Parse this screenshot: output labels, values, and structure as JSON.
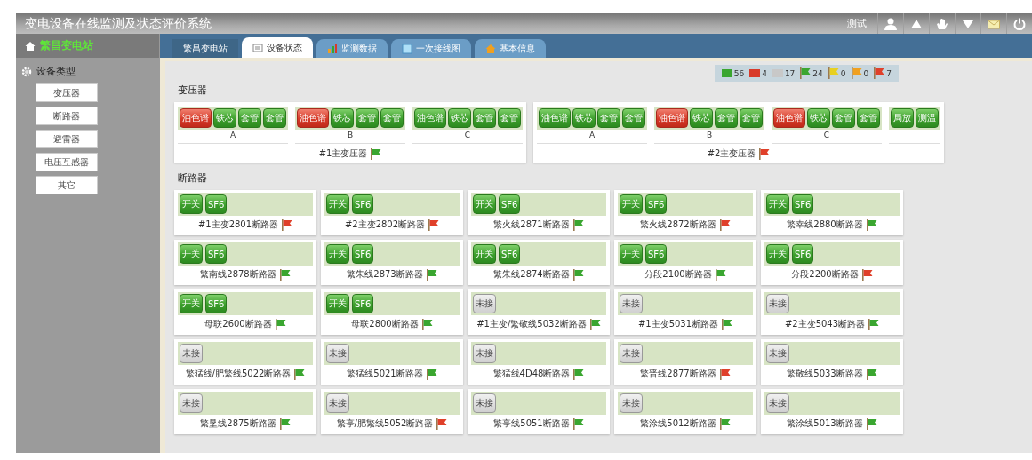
{
  "window": {
    "title": "变电设备在线监测及状态评价系统",
    "user": "测试"
  },
  "station": {
    "name": "繁昌变电站"
  },
  "tabs": [
    {
      "label": "繁昌变电站",
      "selected": false
    },
    {
      "label": "设备状态",
      "selected": true
    },
    {
      "label": "监测数据",
      "selected": false
    },
    {
      "label": "一次接线图",
      "selected": false
    },
    {
      "label": "基本信息",
      "selected": false
    }
  ],
  "sidebar": {
    "title": "设备类型",
    "items": [
      {
        "label": "变压器"
      },
      {
        "label": "断路器"
      },
      {
        "label": "避雷器"
      },
      {
        "label": "电压互感器"
      },
      {
        "label": "其它"
      }
    ]
  },
  "legend": [
    {
      "kind": "block",
      "color": "#3aa630",
      "count": "56"
    },
    {
      "kind": "block",
      "color": "#d83a2a",
      "count": "4"
    },
    {
      "kind": "block",
      "color": "#c8c8c8",
      "count": "17"
    },
    {
      "kind": "flag",
      "color": "#3aa630",
      "count": "24"
    },
    {
      "kind": "flag",
      "color": "#e8d020",
      "count": "0"
    },
    {
      "kind": "flag",
      "color": "#f0a020",
      "count": "0"
    },
    {
      "kind": "flag",
      "color": "#e0402a",
      "count": "7"
    }
  ],
  "transformer_section": {
    "title": "变压器",
    "units": [
      {
        "name": "#1主变压器",
        "color": "#3aa630",
        "groups": [
          {
            "phase": "A",
            "sensors": [
              {
                "label": "油色谱",
                "kind": "alarm"
              },
              {
                "label": "铁芯",
                "kind": "normal"
              },
              {
                "label": "套管",
                "kind": "normal"
              },
              {
                "label": "套管",
                "kind": "normal"
              }
            ]
          },
          {
            "phase": "B",
            "sensors": [
              {
                "label": "油色谱",
                "kind": "alarm"
              },
              {
                "label": "铁芯",
                "kind": "normal"
              },
              {
                "label": "套管",
                "kind": "normal"
              },
              {
                "label": "套管",
                "kind": "normal"
              }
            ]
          },
          {
            "phase": "C",
            "sensors": [
              {
                "label": "油色谱",
                "kind": "normal"
              },
              {
                "label": "铁芯",
                "kind": "normal"
              },
              {
                "label": "套管",
                "kind": "normal"
              },
              {
                "label": "套管",
                "kind": "normal"
              }
            ]
          }
        ]
      },
      {
        "name": "#2主变压器",
        "color": "#e0402a",
        "groups": [
          {
            "phase": "A",
            "sensors": [
              {
                "label": "油色谱",
                "kind": "normal"
              },
              {
                "label": "铁芯",
                "kind": "normal"
              },
              {
                "label": "套管",
                "kind": "normal"
              },
              {
                "label": "套管",
                "kind": "normal"
              }
            ]
          },
          {
            "phase": "B",
            "sensors": [
              {
                "label": "油色谱",
                "kind": "alarm"
              },
              {
                "label": "铁芯",
                "kind": "normal"
              },
              {
                "label": "套管",
                "kind": "normal"
              },
              {
                "label": "套管",
                "kind": "normal"
              }
            ]
          },
          {
            "phase": "C",
            "sensors": [
              {
                "label": "油色谱",
                "kind": "alarm"
              },
              {
                "label": "铁芯",
                "kind": "normal"
              },
              {
                "label": "套管",
                "kind": "normal"
              },
              {
                "label": "套管",
                "kind": "normal"
              }
            ]
          },
          {
            "sensors": [
              {
                "label": "局放",
                "kind": "normal"
              },
              {
                "label": "测温",
                "kind": "normal"
              }
            ]
          }
        ]
      }
    ]
  },
  "breaker_section": {
    "title": "断路器",
    "units": [
      {
        "name": "#1主变2801断路器",
        "color": "#e0402a",
        "sensors": [
          {
            "label": "开关",
            "kind": "normal"
          },
          {
            "label": "SF6",
            "kind": "normal"
          }
        ]
      },
      {
        "name": "#2主变2802断路器",
        "color": "#e0402a",
        "sensors": [
          {
            "label": "开关",
            "kind": "normal"
          },
          {
            "label": "SF6",
            "kind": "normal"
          }
        ]
      },
      {
        "name": "繁火线2871断路器",
        "color": "#3aa630",
        "sensors": [
          {
            "label": "开关",
            "kind": "normal"
          },
          {
            "label": "SF6",
            "kind": "normal"
          }
        ]
      },
      {
        "name": "繁火线2872断路器",
        "color": "#e0402a",
        "sensors": [
          {
            "label": "开关",
            "kind": "normal"
          },
          {
            "label": "SF6",
            "kind": "normal"
          }
        ]
      },
      {
        "name": "繁幸线2880断路器",
        "color": "#3aa630",
        "sensors": [
          {
            "label": "开关",
            "kind": "normal"
          },
          {
            "label": "SF6",
            "kind": "normal"
          }
        ]
      },
      {
        "name": "繁南线2878断路器",
        "color": "#3aa630",
        "sensors": [
          {
            "label": "开关",
            "kind": "normal"
          },
          {
            "label": "SF6",
            "kind": "normal"
          }
        ]
      },
      {
        "name": "繁朱线2873断路器",
        "color": "#3aa630",
        "sensors": [
          {
            "label": "开关",
            "kind": "normal"
          },
          {
            "label": "SF6",
            "kind": "normal"
          }
        ]
      },
      {
        "name": "繁朱线2874断路器",
        "color": "#3aa630",
        "sensors": [
          {
            "label": "开关",
            "kind": "normal"
          },
          {
            "label": "SF6",
            "kind": "normal"
          }
        ]
      },
      {
        "name": "分段2100断路器",
        "color": "#3aa630",
        "sensors": [
          {
            "label": "开关",
            "kind": "normal"
          },
          {
            "label": "SF6",
            "kind": "normal"
          }
        ]
      },
      {
        "name": "分段2200断路器",
        "color": "#e0402a",
        "sensors": [
          {
            "label": "开关",
            "kind": "normal"
          },
          {
            "label": "SF6",
            "kind": "normal"
          }
        ]
      },
      {
        "name": "母联2600断路器",
        "color": "#3aa630",
        "sensors": [
          {
            "label": "开关",
            "kind": "normal"
          },
          {
            "label": "SF6",
            "kind": "normal"
          }
        ]
      },
      {
        "name": "母联2800断路器",
        "color": "#3aa630",
        "sensors": [
          {
            "label": "开关",
            "kind": "normal"
          },
          {
            "label": "SF6",
            "kind": "normal"
          }
        ]
      },
      {
        "name": "#1主变/繁敬线5032断路器",
        "color": "#3aa630",
        "sensors": [
          {
            "label": "未接",
            "kind": "offline"
          }
        ]
      },
      {
        "name": "#1主变5031断路器",
        "color": "#3aa630",
        "sensors": [
          {
            "label": "未接",
            "kind": "offline"
          }
        ]
      },
      {
        "name": "#2主变5043断路器",
        "color": "#3aa630",
        "sensors": [
          {
            "label": "未接",
            "kind": "offline"
          }
        ]
      },
      {
        "name": "繁猛线/肥繁线5022断路器",
        "color": "#3aa630",
        "sensors": [
          {
            "label": "未接",
            "kind": "offline"
          }
        ]
      },
      {
        "name": "繁猛线5021断路器",
        "color": "#3aa630",
        "sensors": [
          {
            "label": "未接",
            "kind": "offline"
          }
        ]
      },
      {
        "name": "繁猛线4D48断路器",
        "color": "#3aa630",
        "sensors": [
          {
            "label": "未接",
            "kind": "offline"
          }
        ]
      },
      {
        "name": "繁晋线2877断路器",
        "color": "#e0402a",
        "sensors": [
          {
            "label": "未接",
            "kind": "offline"
          }
        ]
      },
      {
        "name": "繁敬线5033断路器",
        "color": "#3aa630",
        "sensors": [
          {
            "label": "未接",
            "kind": "offline"
          }
        ]
      },
      {
        "name": "繁垦线2875断路器",
        "color": "#3aa630",
        "sensors": [
          {
            "label": "未接",
            "kind": "offline"
          }
        ]
      },
      {
        "name": "繁亭/肥繁线5052断路器",
        "color": "#e0402a",
        "sensors": [
          {
            "label": "未接",
            "kind": "offline"
          }
        ]
      },
      {
        "name": "繁亭线5051断路器",
        "color": "#3aa630",
        "sensors": [
          {
            "label": "未接",
            "kind": "offline"
          }
        ]
      },
      {
        "name": "繁涂线5012断路器",
        "color": "#3aa630",
        "sensors": [
          {
            "label": "未接",
            "kind": "offline"
          }
        ]
      },
      {
        "name": "繁涂线5013断路器",
        "color": "#3aa630",
        "sensors": [
          {
            "label": "未接",
            "kind": "offline"
          }
        ]
      }
    ]
  }
}
